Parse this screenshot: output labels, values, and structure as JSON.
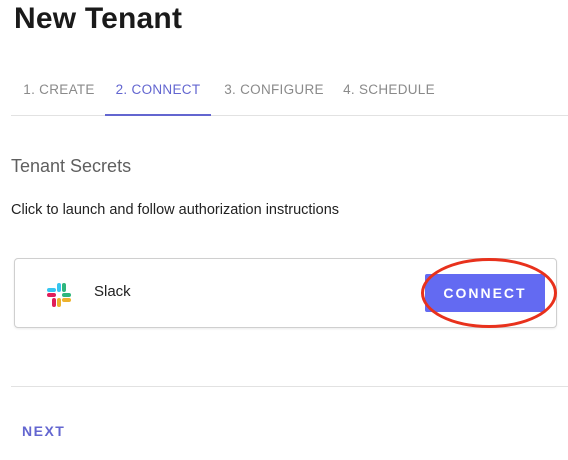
{
  "page": {
    "title": "New Tenant"
  },
  "stepper": {
    "steps": [
      {
        "label": "1. CREATE",
        "active": false
      },
      {
        "label": "2. CONNECT",
        "active": true
      },
      {
        "label": "3. CONFIGURE",
        "active": false
      },
      {
        "label": "4. SCHEDULE",
        "active": false
      }
    ],
    "active_color": "#6366d0"
  },
  "section": {
    "title": "Tenant Secrets",
    "instructions": "Click to launch and follow authorization instructions"
  },
  "integrations": [
    {
      "name": "Slack",
      "icon": "slack-logo-icon",
      "action_label": "CONNECT",
      "action_color": "#636af2"
    }
  ],
  "annotation": {
    "highlight_color": "#e8311c"
  },
  "footer": {
    "next_label": "NEXT"
  }
}
